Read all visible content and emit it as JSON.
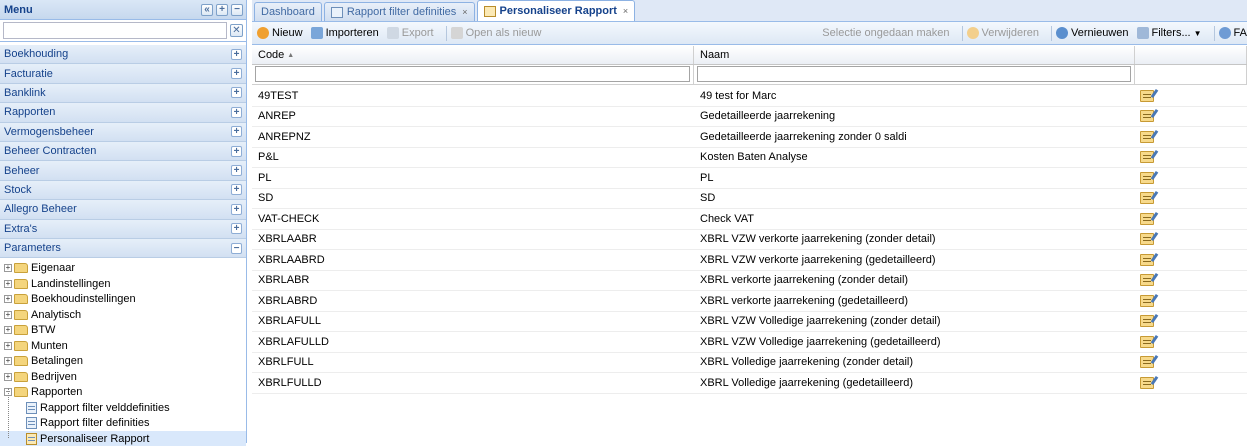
{
  "menu": {
    "title": "Menu",
    "search_value": "",
    "sections": [
      {
        "label": "Boekhouding",
        "toggle": "+"
      },
      {
        "label": "Facturatie",
        "toggle": "+"
      },
      {
        "label": "Banklink",
        "toggle": "+"
      },
      {
        "label": "Rapporten",
        "toggle": "+"
      },
      {
        "label": "Vermogensbeheer",
        "toggle": "+"
      },
      {
        "label": "Beheer Contracten",
        "toggle": "+"
      },
      {
        "label": "Beheer",
        "toggle": "+"
      },
      {
        "label": "Stock",
        "toggle": "+"
      },
      {
        "label": "Allegro Beheer",
        "toggle": "+"
      },
      {
        "label": "Extra's",
        "toggle": "+"
      },
      {
        "label": "Parameters",
        "toggle": "−"
      }
    ],
    "tree": [
      {
        "label": "Eigenaar",
        "exp": "+"
      },
      {
        "label": "Landinstellingen",
        "exp": "+"
      },
      {
        "label": "Boekhoudinstellingen",
        "exp": "+"
      },
      {
        "label": "Analytisch",
        "exp": "+"
      },
      {
        "label": "BTW",
        "exp": "+"
      },
      {
        "label": "Munten",
        "exp": "+"
      },
      {
        "label": "Betalingen",
        "exp": "+"
      },
      {
        "label": "Bedrijven",
        "exp": "+"
      },
      {
        "label": "Rapporten",
        "exp": "−"
      }
    ],
    "leaves": [
      {
        "label": "Rapport filter velddefinities"
      },
      {
        "label": "Rapport filter definities"
      },
      {
        "label": "Personaliseer Rapport"
      }
    ]
  },
  "tabs": [
    {
      "label": "Dashboard"
    },
    {
      "label": "Rapport filter definities",
      "close": "×"
    },
    {
      "label": "Personaliseer Rapport",
      "close": "×"
    }
  ],
  "toolbar": {
    "new": "Nieuw",
    "import": "Importeren",
    "export": "Export",
    "open_new": "Open als nieuw",
    "undo_selection": "Selectie ongedaan maken",
    "delete": "Verwijderen",
    "refresh": "Vernieuwen",
    "filters": "Filters...",
    "fav": "FA"
  },
  "grid": {
    "columns": {
      "code": "Code",
      "code_sort": "▲",
      "name": "Naam"
    },
    "filter_code": "",
    "filter_name": "",
    "rows": [
      {
        "code": "49TEST",
        "name": "49 test for Marc"
      },
      {
        "code": "ANREP",
        "name": "Gedetailleerde jaarrekening"
      },
      {
        "code": "ANREPNZ",
        "name": "Gedetailleerde jaarrekening zonder 0 saldi"
      },
      {
        "code": "P&L",
        "name": "Kosten Baten Analyse"
      },
      {
        "code": "PL",
        "name": "PL"
      },
      {
        "code": "SD",
        "name": "SD"
      },
      {
        "code": "VAT-CHECK",
        "name": "Check VAT"
      },
      {
        "code": "XBRLAABR",
        "name": "XBRL VZW verkorte jaarrekening (zonder detail)"
      },
      {
        "code": "XBRLAABRD",
        "name": "XBRL VZW verkorte jaarrekening (gedetailleerd)"
      },
      {
        "code": "XBRLABR",
        "name": "XBRL verkorte jaarrekening (zonder detail)"
      },
      {
        "code": "XBRLABRD",
        "name": "XBRL verkorte jaarrekening (gedetailleerd)"
      },
      {
        "code": "XBRLAFULL",
        "name": "XBRL VZW Volledige jaarrekening (zonder detail)"
      },
      {
        "code": "XBRLAFULLD",
        "name": "XBRL VZW Volledige jaarrekening (gedetailleerd)"
      },
      {
        "code": "XBRLFULL",
        "name": "XBRL Volledige jaarrekening (zonder detail)"
      },
      {
        "code": "XBRLFULLD",
        "name": "XBRL Volledige jaarrekening (gedetailleerd)"
      }
    ]
  }
}
